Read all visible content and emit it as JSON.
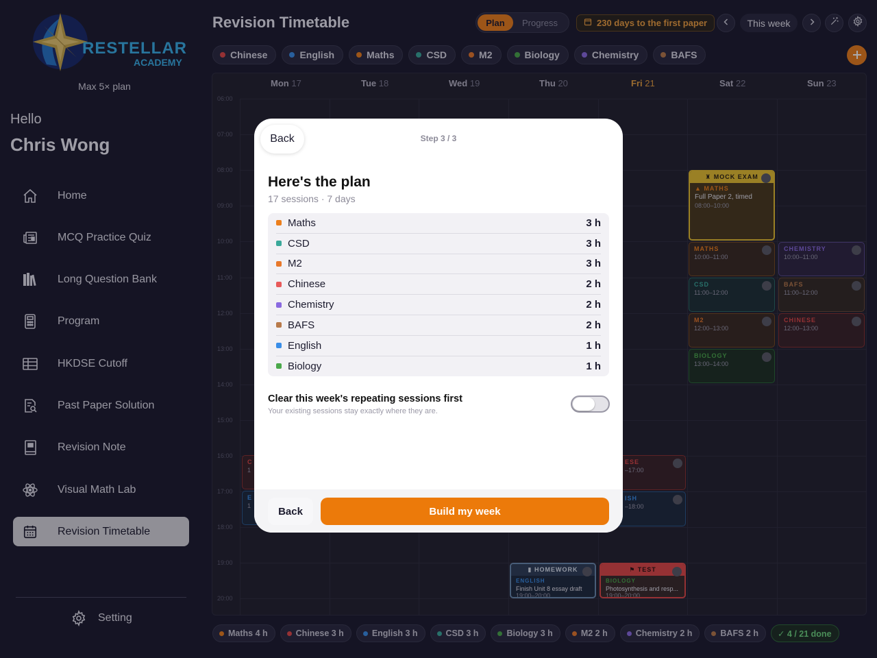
{
  "sidebar": {
    "logo_text": "RESTELLAR",
    "logo_sub": "ACADEMY",
    "plan": "Max 5× plan",
    "greeting": "Hello",
    "user_name": "Chris Wong",
    "items": [
      {
        "label": "Home",
        "icon": "home-icon"
      },
      {
        "label": "MCQ Practice Quiz",
        "icon": "newspaper-icon"
      },
      {
        "label": "Long Question Bank",
        "icon": "books-icon"
      },
      {
        "label": "Program",
        "icon": "calculator-icon"
      },
      {
        "label": "HKDSE Cutoff",
        "icon": "table-icon"
      },
      {
        "label": "Past Paper Solution",
        "icon": "document-search-icon"
      },
      {
        "label": "Revision Note",
        "icon": "notebook-icon"
      },
      {
        "label": "Visual Math Lab",
        "icon": "atom-icon"
      },
      {
        "label": "Revision Timetable",
        "icon": "calendar-icon",
        "active": true
      }
    ],
    "setting_label": "Setting"
  },
  "header": {
    "title": "Revision Timetable",
    "seg_plan": "Plan",
    "seg_progress": "Progress",
    "countdown": "230 days to the first paper",
    "this_week": "This week",
    "subjects": [
      {
        "label": "Chinese",
        "color": "#e04848"
      },
      {
        "label": "English",
        "color": "#3a8ee8"
      },
      {
        "label": "Maths",
        "color": "#ec7f1c"
      },
      {
        "label": "CSD",
        "color": "#3aa89a"
      },
      {
        "label": "M2",
        "color": "#e8782a"
      },
      {
        "label": "Biology",
        "color": "#4aa84a"
      },
      {
        "label": "Chemistry",
        "color": "#8a6ae0"
      },
      {
        "label": "BAFS",
        "color": "#b87a4a"
      }
    ]
  },
  "calendar": {
    "days": [
      {
        "name": "Mon",
        "num": "17"
      },
      {
        "name": "Tue",
        "num": "18"
      },
      {
        "name": "Wed",
        "num": "19"
      },
      {
        "name": "Thu",
        "num": "20"
      },
      {
        "name": "Fri",
        "num": "21"
      },
      {
        "name": "Sat",
        "num": "22"
      },
      {
        "name": "Sun",
        "num": "23"
      }
    ],
    "hours": [
      "06:00",
      "07:00",
      "08:00",
      "09:00",
      "10:00",
      "11:00",
      "12:00",
      "13:00",
      "14:00",
      "15:00",
      "16:00",
      "17:00",
      "18:00",
      "19:00",
      "20:00"
    ],
    "events": {
      "mock_badge": "MOCK EXAM",
      "mock_subject": "MATHS",
      "mock_desc": "Full Paper 2, timed",
      "mock_time": "08:00–10:00",
      "sat_maths": "MATHS",
      "sat_maths_time": "10:00–11:00",
      "sat_csd": "CSD",
      "sat_csd_time": "11:00–12:00",
      "sat_m2": "M2",
      "sat_m2_time": "12:00–13:00",
      "sat_bio": "BIOLOGY",
      "sat_bio_time": "13:00–14:00",
      "sun_chem": "CHEMISTRY",
      "sun_chem_time": "10:00–11:00",
      "sun_bafs": "BAFS",
      "sun_bafs_time": "11:00–12:00",
      "sun_chinese": "CHINESE",
      "sun_chinese_time": "12:00–13:00",
      "fri_chinese_partial": "ESE",
      "fri_chinese_time_partial": "–17:00",
      "fri_english_partial": "ISH",
      "fri_english_time_partial": "–18:00",
      "mon_c_partial": "C",
      "mon_c_time_partial": "1",
      "mon_e_partial": "E",
      "mon_e_time_partial": "1",
      "hw_badge": "HOMEWORK",
      "hw_subject": "ENGLISH",
      "hw_desc": "Finish Unit 8 essay draft",
      "hw_time": "19:00–20:00",
      "test_badge": "TEST",
      "test_subject": "BIOLOGY",
      "test_desc": "Photosynthesis and resp...",
      "test_time": "19:00–20:00"
    }
  },
  "modal": {
    "back_top": "Back",
    "step": "Step 3 / 3",
    "title": "Here's the plan",
    "subtitle": "17 sessions · 7 days",
    "rows": [
      {
        "name": "Maths",
        "hours": "3 h",
        "color": "#ec7f1c"
      },
      {
        "name": "CSD",
        "hours": "3 h",
        "color": "#3aa89a"
      },
      {
        "name": "M2",
        "hours": "3 h",
        "color": "#e8782a"
      },
      {
        "name": "Chinese",
        "hours": "2 h",
        "color": "#e85a5a"
      },
      {
        "name": "Chemistry",
        "hours": "2 h",
        "color": "#8a6ae0"
      },
      {
        "name": "BAFS",
        "hours": "2 h",
        "color": "#b87a4a"
      },
      {
        "name": "English",
        "hours": "1 h",
        "color": "#3a8ee8"
      },
      {
        "name": "Biology",
        "hours": "1 h",
        "color": "#4aa84a"
      }
    ],
    "clear_label": "Clear this week's repeating sessions first",
    "clear_sub": "Your existing sessions stay exactly where they are.",
    "toggle_on": false,
    "back_bottom": "Back",
    "build": "Build my week"
  },
  "summary": [
    {
      "label": "Maths 4 h",
      "color": "#ec7f1c"
    },
    {
      "label": "Chinese 3 h",
      "color": "#e04848"
    },
    {
      "label": "English 3 h",
      "color": "#3a8ee8"
    },
    {
      "label": "CSD 3 h",
      "color": "#3aa89a"
    },
    {
      "label": "Biology 3 h",
      "color": "#4aa84a"
    },
    {
      "label": "M2 2 h",
      "color": "#e8782a"
    },
    {
      "label": "Chemistry 2 h",
      "color": "#8a6ae0"
    },
    {
      "label": "BAFS 2 h",
      "color": "#b87a4a"
    }
  ],
  "summary_done": "✓ 4 / 21 done",
  "colors": {
    "accent": "#ec7f1c",
    "background": "#1c1b2e"
  }
}
